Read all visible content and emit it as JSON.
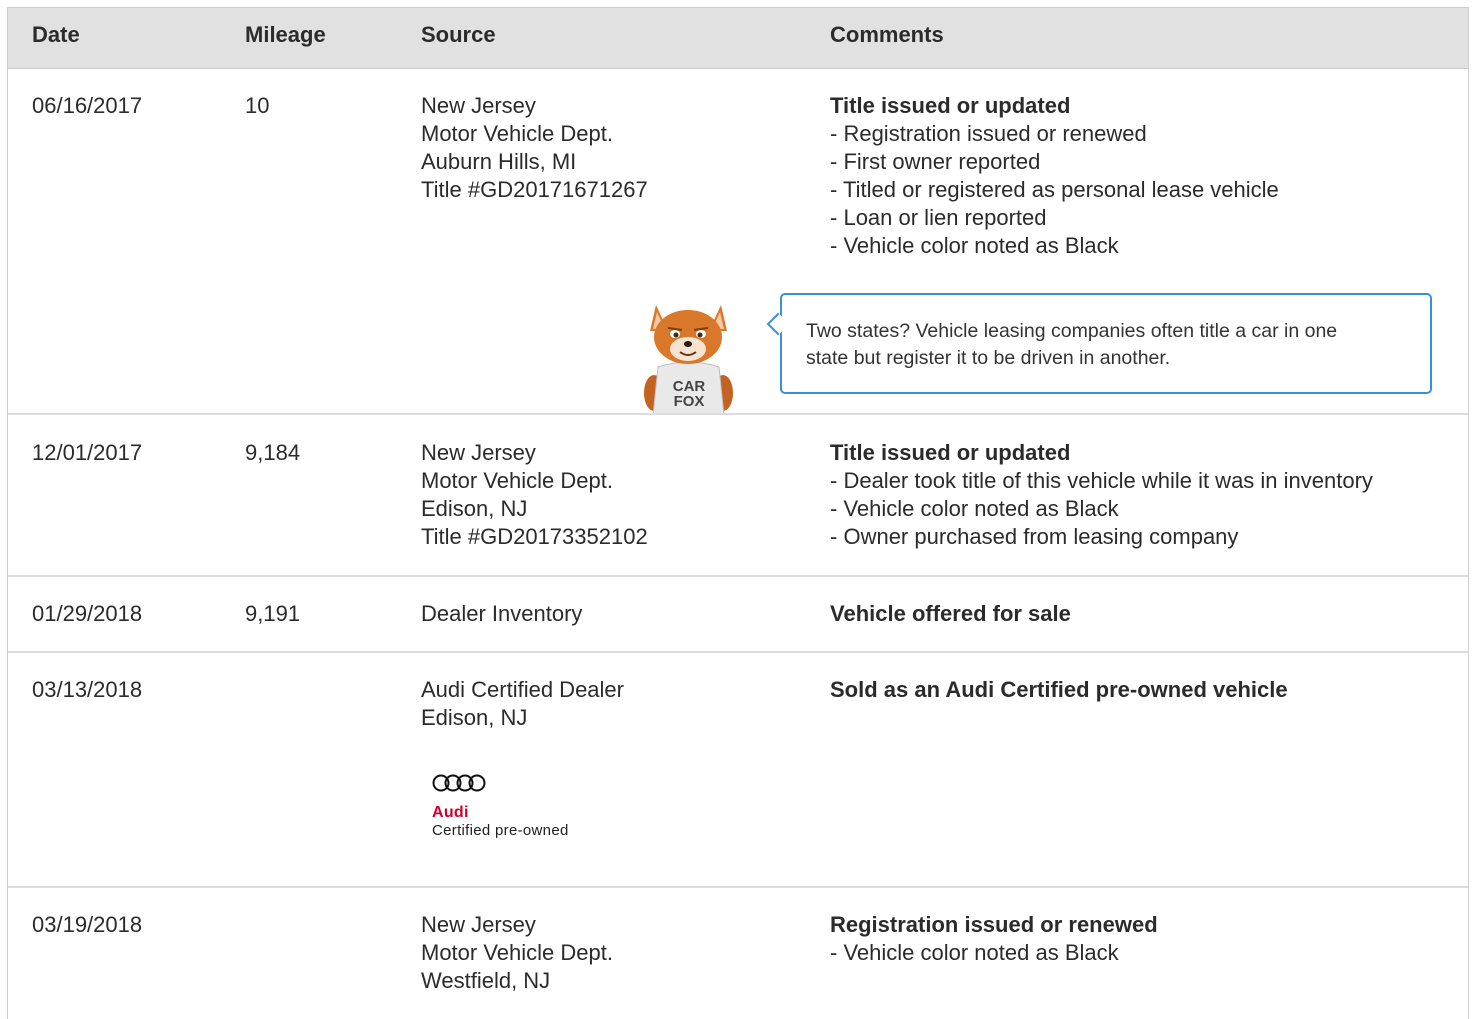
{
  "header": {
    "date": "Date",
    "mileage": "Mileage",
    "source": "Source",
    "comments": "Comments"
  },
  "records": [
    {
      "date": "06/16/2017",
      "mileage": "10",
      "source": [
        "New Jersey",
        "Motor Vehicle Dept.",
        "Auburn Hills, MI",
        "Title #GD20171671267"
      ],
      "comment_title": "Title issued or updated",
      "comment_items": [
        "Registration issued or renewed",
        "First owner reported",
        "Titled or registered as personal lease vehicle",
        "Loan or lien reported",
        "Vehicle color noted as Black"
      ]
    },
    {
      "date": "12/01/2017",
      "mileage": "9,184",
      "source": [
        "New Jersey",
        "Motor Vehicle Dept.",
        "Edison, NJ",
        "Title #GD20173352102"
      ],
      "comment_title": "Title issued or updated",
      "comment_items": [
        "Dealer took title of this vehicle while it was in inventory",
        "Vehicle color noted as Black",
        "Owner purchased from leasing company"
      ]
    },
    {
      "date": "01/29/2018",
      "mileage": "9,191",
      "source": [
        "Dealer Inventory"
      ],
      "comment_title": "Vehicle offered for sale",
      "comment_items": []
    },
    {
      "date": "03/13/2018",
      "mileage": "",
      "source": [
        "Audi Certified Dealer",
        "Edison, NJ"
      ],
      "comment_title": "Sold as an Audi Certified pre-owned vehicle",
      "comment_items": []
    },
    {
      "date": "03/19/2018",
      "mileage": "",
      "source": [
        "New Jersey",
        "Motor Vehicle Dept.",
        "Westfield, NJ"
      ],
      "comment_title": "Registration issued or renewed",
      "comment_items": [
        "Vehicle color noted as Black"
      ]
    }
  ],
  "tooltip": {
    "text_line1": "Two states? Vehicle leasing companies often title a car in one",
    "text_line2": "state but register it to be driven in another."
  },
  "mascot": {
    "shirt_line1": "CAR",
    "shirt_line2": "FOX",
    "icon": "carfox-mascot-icon"
  },
  "audi_logo": {
    "brand": "Audi",
    "subtitle": "Certified pre-owned",
    "icon": "audi-rings-icon",
    "brand_color": "#cc0033"
  },
  "colors": {
    "header_bg": "#e1e1e1",
    "tooltip_border": "#3b8fd6"
  }
}
